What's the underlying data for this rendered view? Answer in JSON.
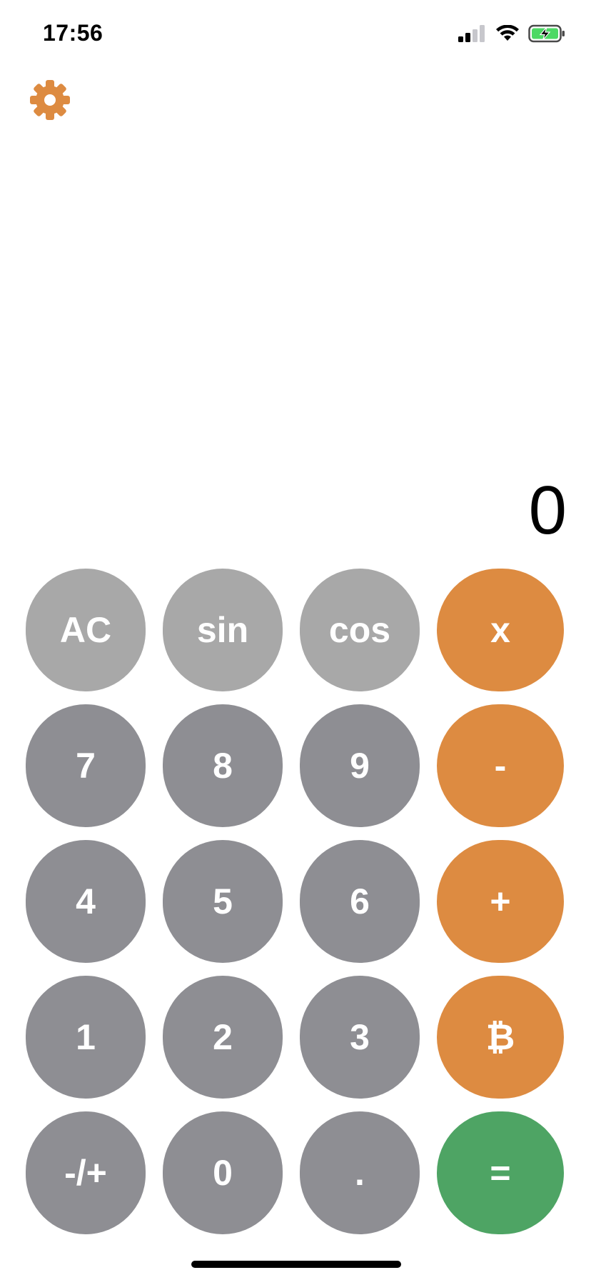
{
  "status_bar": {
    "time": "17:56",
    "icons": [
      "cellular-signal-icon",
      "wifi-icon",
      "battery-charging-icon"
    ]
  },
  "settings": {
    "icon": "gear-icon",
    "color": "#dd8b41"
  },
  "display": {
    "value": "0"
  },
  "keys": {
    "ac": "AC",
    "sin": "sin",
    "cos": "cos",
    "multiply": "x",
    "seven": "7",
    "eight": "8",
    "nine": "9",
    "subtract": "-",
    "four": "4",
    "five": "5",
    "six": "6",
    "add": "+",
    "one": "1",
    "two": "2",
    "three": "3",
    "bitcoin": "₿",
    "negate": "-/+",
    "zero": "0",
    "decimal": ".",
    "equals": "="
  },
  "colors": {
    "function_key": "#a8a8a8",
    "number_key": "#8e8e93",
    "operator_key": "#dd8b41",
    "equals_key": "#4ea464",
    "battery_fill": "#4cd964"
  }
}
